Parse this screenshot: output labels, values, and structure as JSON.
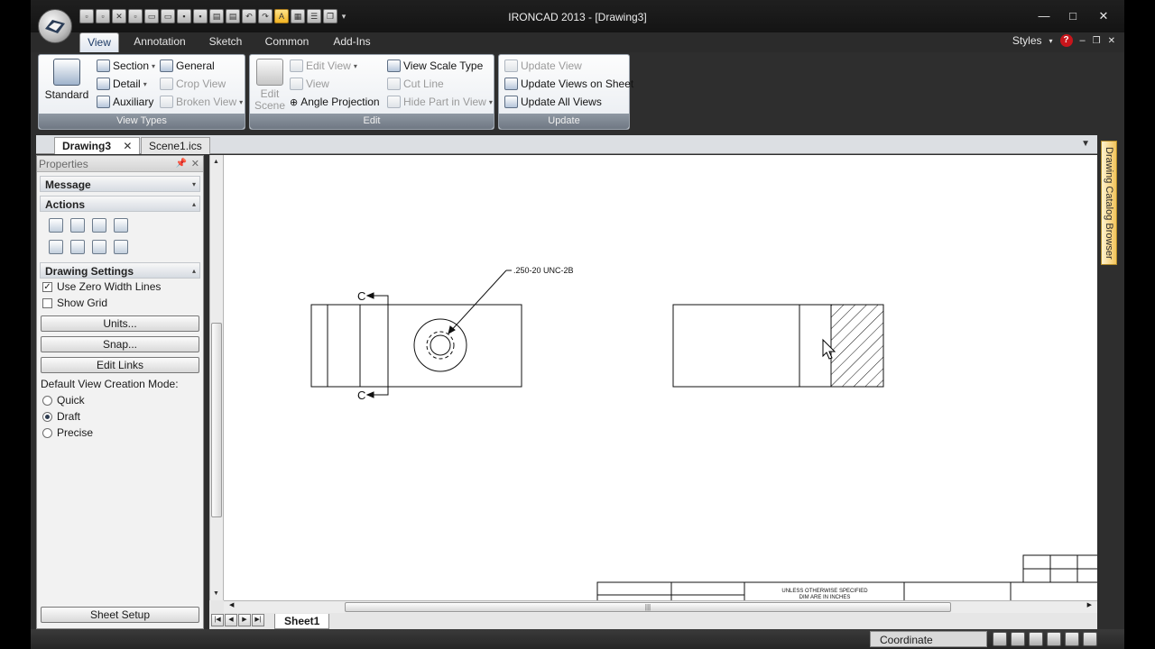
{
  "window": {
    "title": "IRONCAD 2013 - [Drawing3]",
    "controls": {
      "minimize": "—",
      "maximize": "□",
      "close": "✕"
    },
    "doc_controls": {
      "minimize": "–",
      "restore": "❐",
      "close": "✕"
    }
  },
  "ribbon_tabs": [
    "View",
    "Annotation",
    "Sketch",
    "Common",
    "Add-Ins"
  ],
  "active_tab": "View",
  "styles_label": "Styles",
  "help_label": "?",
  "groups": {
    "view_types": {
      "label": "View Types",
      "standard": "Standard",
      "section": "Section",
      "general": "General",
      "detail": "Detail",
      "crop_view": "Crop View",
      "auxiliary": "Auxiliary",
      "broken_view": "Broken View"
    },
    "edit": {
      "label": "Edit",
      "edit_scene_1": "Edit",
      "edit_scene_2": "Scene",
      "edit_view": "Edit View",
      "view": "View",
      "angle_projection": "Angle Projection",
      "view_scale_type": "View Scale Type",
      "cut_line": "Cut Line",
      "hide_part": "Hide Part in View"
    },
    "update": {
      "label": "Update",
      "update_view": "Update View",
      "update_views_on_sheet": "Update Views on Sheet",
      "update_all_views": "Update All Views"
    }
  },
  "doc_tabs": [
    {
      "label": "Drawing3",
      "close": "✕"
    },
    {
      "label": "Scene1.ics"
    }
  ],
  "properties": {
    "header": "Properties",
    "message": "Message",
    "actions": "Actions",
    "drawing_settings": "Drawing Settings",
    "use_zero_width_lines": "Use Zero Width Lines",
    "use_zero_width_checked": "✓",
    "show_grid": "Show Grid",
    "units_btn": "Units...",
    "snap_btn": "Snap...",
    "edit_links_btn": "Edit Links",
    "default_mode_label": "Default View Creation Mode:",
    "modes": [
      "Quick",
      "Draft",
      "Precise"
    ],
    "selected_mode": "Draft",
    "sheet_setup": "Sheet Setup"
  },
  "drawing": {
    "callout": ".250-20 UNC-2B",
    "section_letter_top": "C",
    "section_letter_bottom": "C",
    "title_block_note_1": "UNLESS OTHERWISE SPECIFIED",
    "title_block_note_2": "DIM ARE IN INCHES"
  },
  "catalog_tab": "Drawing Catalog Browser",
  "sheet_tab": "Sheet1",
  "sheet_nav": [
    "|◀",
    "◀",
    "▶",
    "▶|"
  ],
  "scroll_grip": "|||",
  "status": {
    "coordinate": "Coordinate"
  },
  "colors": {
    "ribbon_dark": "#2e2e2e",
    "group_label": "#7a838e",
    "catalog_accent": "#f2c35a",
    "help_red": "#c8151b"
  }
}
